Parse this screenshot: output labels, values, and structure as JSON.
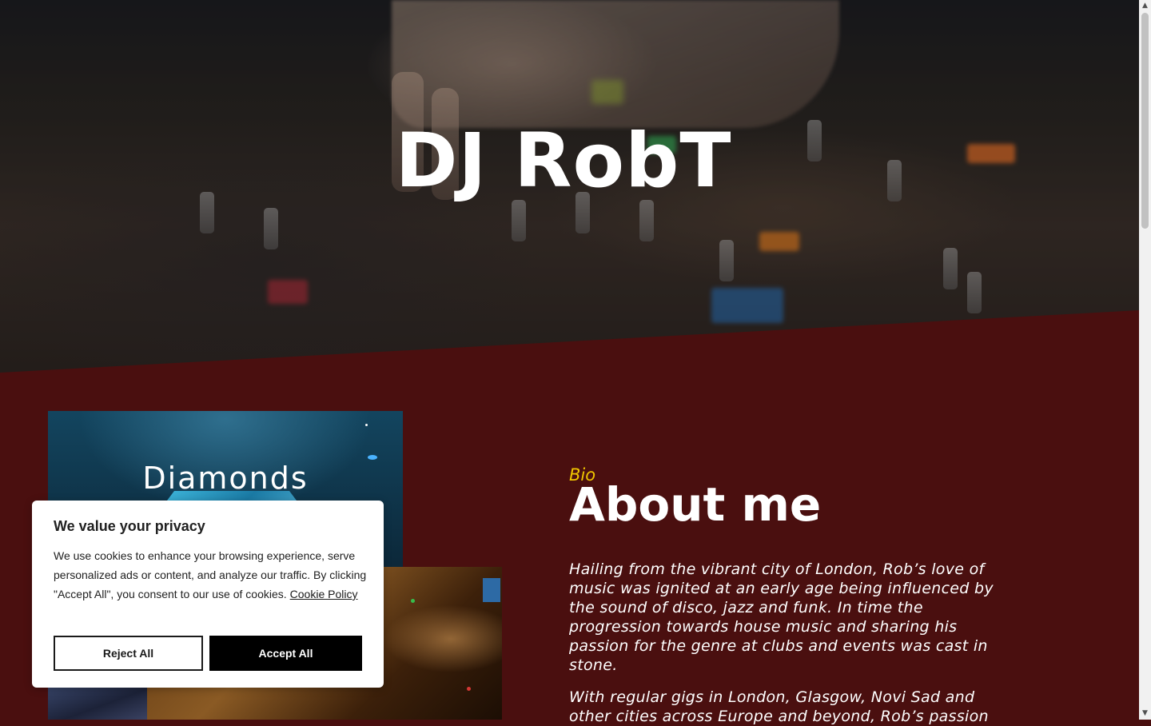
{
  "hero": {
    "title": "DJ RobT"
  },
  "album": {
    "title": "Diamonds"
  },
  "bio": {
    "label": "Bio",
    "heading": "About me",
    "paragraphs": [
      "Hailing from the vibrant city of London, Rob’s love of music was ignited at an early age being influenced by the sound of disco, jazz and funk. In time the progression towards house music and sharing his passion for the genre at clubs and events was cast in stone.",
      "With regular gigs in London, Glasgow, Novi Sad and other cities across Europe and beyond, Rob’s passion"
    ]
  },
  "cookie": {
    "title": "We value your privacy",
    "text": "We use cookies to enhance your browsing experience, serve personalized ads or content, and analyze our traffic. By clicking \"Accept All\", you consent to our use of cookies.",
    "policy_link": "Cookie Policy",
    "reject_label": "Reject All",
    "accept_label": "Accept All"
  },
  "colors": {
    "section_bg": "#4a0f0f",
    "accent": "#f0c600",
    "button_dark": "#000000"
  },
  "scrollbar": {
    "up_icon": "scroll-up-arrow-icon",
    "down_icon": "scroll-down-arrow-icon"
  }
}
